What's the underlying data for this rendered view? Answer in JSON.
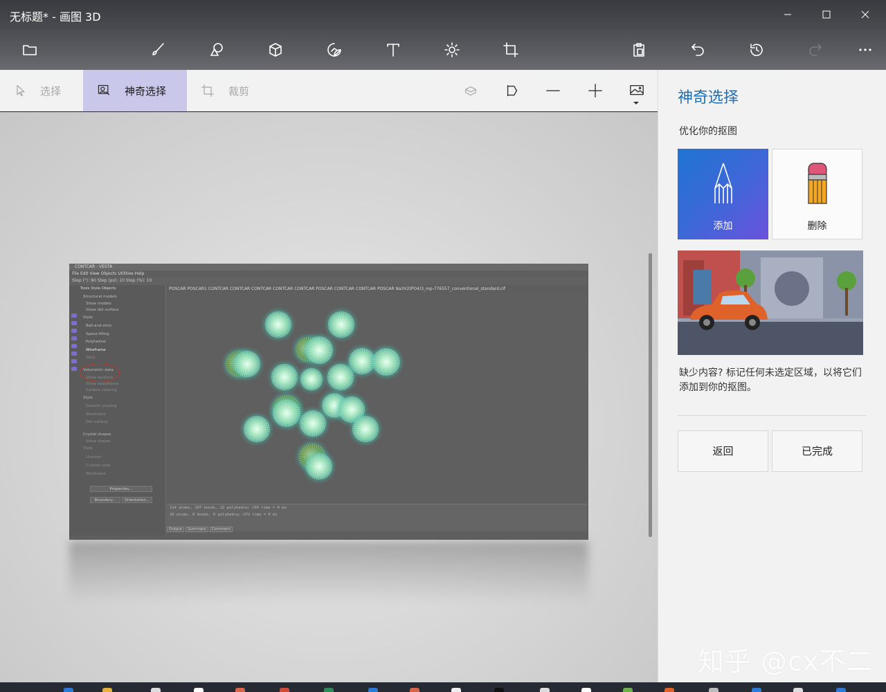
{
  "window": {
    "title": "无标题* - 画图 3D",
    "minimize": "—",
    "maximize": "☐",
    "close": "✕"
  },
  "main_toolbar": {
    "tools": [
      {
        "name": "menu-folder-icon"
      },
      {
        "name": "brushes-icon"
      },
      {
        "name": "2d-shapes-icon"
      },
      {
        "name": "3d-shapes-icon"
      },
      {
        "name": "stickers-icon"
      },
      {
        "name": "text-icon"
      },
      {
        "name": "effects-icon"
      },
      {
        "name": "canvas-icon"
      },
      {
        "name": "paste-icon"
      },
      {
        "name": "undo-icon"
      },
      {
        "name": "history-icon"
      },
      {
        "name": "redo-icon"
      },
      {
        "name": "more-icon"
      }
    ]
  },
  "sub_toolbar": {
    "select": "选择",
    "magic_select": "神奇选择",
    "crop": "裁剪"
  },
  "vesta": {
    "title": "CONTCAR - VESTA",
    "menu": "File  Edit  View  Objects  Utilities  Help",
    "toolbar": "Step (°): 90    Step (px): 10    Step (%): 10",
    "tabs": "POSCAR  POSCAR1  CONTCAR  CONTCAR  CONTCAR  CONTCAR  CONTCAR  POSCAR  CONTCAR  CONTCAR  POSCAR  Na3V2(PO4)3_mp-776557_conventional_standard.cif",
    "left_tabs": "Tools  Style  Objects",
    "panel_rows": [
      "Structural models",
      "Show models",
      "Show dot surface",
      "Style",
      "Ball-and-stick",
      "Space-filling",
      "Polyhedral",
      "Wireframe",
      "Stick",
      "Volumetric data",
      "Show sections",
      "Show isosurfaces",
      "Surface coloring",
      "Style",
      "Smooth shading",
      "Wireframe",
      "Dot surface",
      "Crystal shapes",
      "Show shapes",
      "Style",
      "Unicolor",
      "Custom color",
      "Wireframe"
    ],
    "buttons": {
      "properties": "Properties...",
      "boundary": "Boundary...",
      "orientation": "Orientation..."
    },
    "output_lines": [
      "114 atoms, 107 bonds, 22 polyhedra; CPU time = 0 ms",
      "20 atoms, 0 bonds, 0 polyhedra; CPU time = 0 ms"
    ],
    "output_tabs": [
      "Output",
      "Summary",
      "Comment"
    ]
  },
  "panel": {
    "title": "神奇选择",
    "subtitle": "优化你的抠图",
    "add_label": "添加",
    "remove_label": "删除",
    "description": "缺少内容? 标记任何未选定区域，以将它们添加到你的抠图。",
    "back_label": "返回",
    "done_label": "已完成"
  },
  "watermark": "知乎 @cx不二",
  "colors": {
    "accent": "#1e6fb5",
    "active_tab": "#c9c8ea",
    "card_gradient_start": "#1f74d1",
    "card_gradient_end": "#6a52dd"
  }
}
